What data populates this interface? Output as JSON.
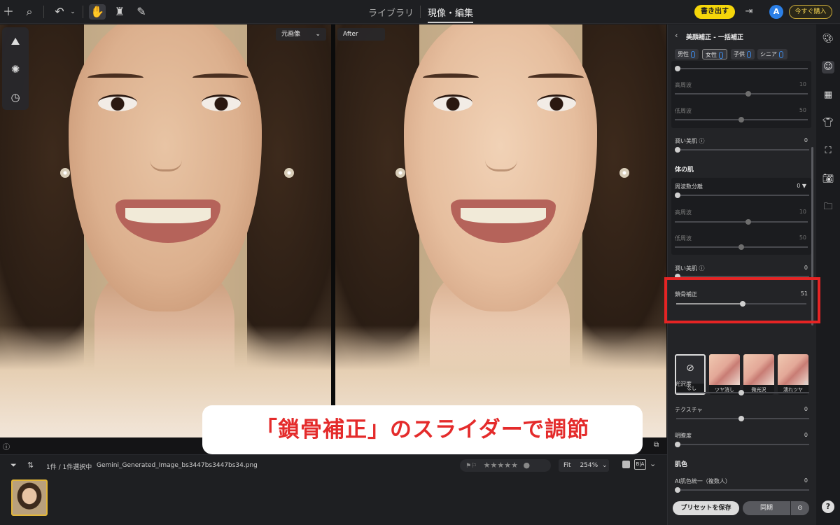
{
  "topbar": {
    "nav_library": "ライブラリ",
    "nav_develop": "現像・編集",
    "export_label": "書き出す",
    "avatar_initial": "A",
    "buy_label": "今すぐ購入"
  },
  "viewer": {
    "before_label": "元画像",
    "after_label": "After"
  },
  "callout": {
    "text": "「鎖骨補正」のスライダーで調節"
  },
  "filmstrip": {
    "selection_text": "1件 / 1件選択中",
    "filename": "Gemini_Generated_Image_bs3447bs3447bs34.png",
    "stars": "★★★★★",
    "fit_label": "Fit",
    "zoom_value": "254%"
  },
  "panel": {
    "title": "美顔補正 - 一括補正",
    "chips": [
      {
        "label": "男性"
      },
      {
        "label": "女性"
      },
      {
        "label": "子供"
      },
      {
        "label": "シニア"
      }
    ],
    "face_skin": {
      "high_freq_label": "高周波",
      "high_freq_value": "10",
      "low_freq_label": "低周波",
      "low_freq_value": "50",
      "moist_label": "潤い美肌 ⓘ",
      "moist_value": "0"
    },
    "body_skin": {
      "section": "体の肌",
      "freq_sep_label": "周波数分離",
      "freq_sep_value": "0 ▼",
      "high_freq_label": "高周波",
      "high_freq_value": "10",
      "low_freq_label": "低周波",
      "low_freq_value": "50",
      "moist_label": "潤い美肌 ⓘ",
      "moist_value": "0",
      "collarbone_label": "鎖骨補正",
      "collarbone_value": "51",
      "collarbone_level": 51
    },
    "gloss_presets": [
      {
        "label": "なし"
      },
      {
        "label": "ツヤ消し"
      },
      {
        "label": "微光沢"
      },
      {
        "label": "濡れツヤ"
      }
    ],
    "gloss_label": "光沢度",
    "gloss_value": "0",
    "texture_label": "テクスチャ",
    "texture_value": "0",
    "clarity_label": "明瞭度",
    "clarity_value": "0",
    "skin_color_section": "肌色",
    "ai_unify_label": "AI肌色統一（複数人）",
    "ai_unify_value": "0",
    "save_preset_label": "プリセットを保存",
    "sync_label": "同期"
  },
  "colors": {
    "accent_yellow": "#f5d60a",
    "highlight_red": "#e52424",
    "callout_red": "#e42b2b"
  },
  "icons": [
    "plus-icon",
    "search-icon",
    "undo-icon",
    "hand-icon",
    "stamp-icon",
    "bandage-icon",
    "palette-icon",
    "face-icon",
    "gradient-icon",
    "shirt-icon",
    "crop-icon",
    "camera-icon",
    "folder-settings-icon",
    "help-icon"
  ]
}
